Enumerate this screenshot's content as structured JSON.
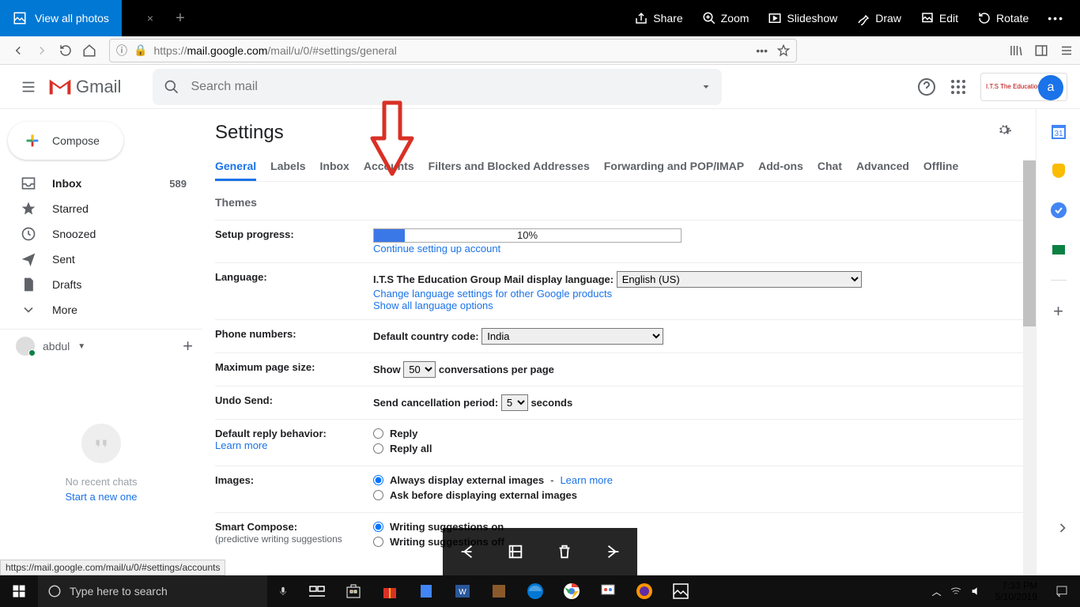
{
  "photos": {
    "view_all": "View all photos",
    "tab_close": "×",
    "tools": {
      "share": "Share",
      "zoom": "Zoom",
      "slideshow": "Slideshow",
      "draw": "Draw",
      "edit": "Edit",
      "rotate": "Rotate"
    }
  },
  "browser": {
    "url_prefix": "https://",
    "url_host": "mail.google.com",
    "url_path": "/mail/u/0/#settings/general"
  },
  "gmail": {
    "logo_text": "Gmail",
    "search_placeholder": "Search mail",
    "avatar_letter": "a",
    "org_text": "I.T.S The Education Group"
  },
  "sidebar": {
    "compose": "Compose",
    "items": [
      {
        "label": "Inbox",
        "count": "589",
        "bold": true
      },
      {
        "label": "Starred"
      },
      {
        "label": "Snoozed"
      },
      {
        "label": "Sent"
      },
      {
        "label": "Drafts"
      },
      {
        "label": "More"
      }
    ],
    "user": "abdul",
    "no_chats": "No recent chats",
    "start_chat": "Start a new one"
  },
  "settings": {
    "title": "Settings",
    "tabs": [
      "General",
      "Labels",
      "Inbox",
      "Accounts",
      "Filters and Blocked Addresses",
      "Forwarding and POP/IMAP",
      "Add-ons",
      "Chat",
      "Advanced",
      "Offline"
    ],
    "tabs2": "Themes",
    "rows": {
      "setup": {
        "label": "Setup progress:",
        "percent": "10%",
        "link": "Continue setting up account"
      },
      "language": {
        "label": "Language:",
        "display": "I.T.S The Education Group Mail display language:",
        "selected": "English (US)",
        "link1": "Change language settings for other Google products",
        "link2": "Show all language options"
      },
      "phone": {
        "label": "Phone numbers:",
        "text": "Default country code:",
        "selected": "India"
      },
      "pagesize": {
        "label": "Maximum page size:",
        "show": "Show",
        "sel": "50",
        "after": "conversations per page"
      },
      "undo": {
        "label": "Undo Send:",
        "text": "Send cancellation period:",
        "sel": "5",
        "after": "seconds"
      },
      "reply": {
        "label": "Default reply behavior:",
        "learn": "Learn more",
        "opt1": "Reply",
        "opt2": "Reply all"
      },
      "images": {
        "label": "Images:",
        "opt1": "Always display external images",
        "learn": "Learn more",
        "opt2": "Ask before displaying external images"
      },
      "smart": {
        "label": "Smart Compose:",
        "sub": "(predictive writing suggestions",
        "opt1": "Writing suggestions on",
        "opt2": "Writing suggestions off"
      }
    }
  },
  "status_link": "https://mail.google.com/mail/u/0/#settings/accounts",
  "taskbar": {
    "search_placeholder": "Type here to search",
    "time": "7:33 PM",
    "date": "5/10/2019"
  }
}
